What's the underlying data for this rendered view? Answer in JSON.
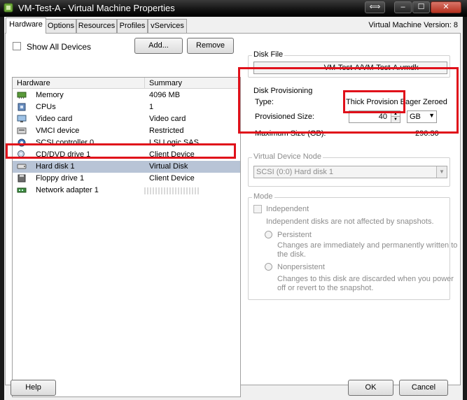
{
  "window": {
    "title": "VM-Test-A - Virtual Machine Properties",
    "version_label": "Virtual Machine Version: 8",
    "close_glyph": "✕",
    "min_glyph": "‒",
    "max_glyph": "☐",
    "resize_glyph": "⟺"
  },
  "tabs": [
    "Hardware",
    "Options",
    "Resources",
    "Profiles",
    "vServices"
  ],
  "toolbar": {
    "show_all_devices": "Show All Devices",
    "add_label": "Add...",
    "remove_label": "Remove"
  },
  "hardware": {
    "col_hardware": "Hardware",
    "col_summary": "Summary",
    "rows": [
      {
        "name": "Memory",
        "summary": "4096 MB",
        "icon": "memory-icon"
      },
      {
        "name": "CPUs",
        "summary": "1",
        "icon": "cpu-icon"
      },
      {
        "name": "Video card",
        "summary": "Video card",
        "icon": "monitor-icon"
      },
      {
        "name": "VMCI device",
        "summary": "Restricted",
        "icon": "vmci-icon"
      },
      {
        "name": "SCSI controller 0",
        "summary": "LSI Logic SAS",
        "icon": "scsi-icon"
      },
      {
        "name": "CD/DVD drive 1",
        "summary": "Client Device",
        "icon": "cd-drive-icon"
      },
      {
        "name": "Hard disk 1",
        "summary": "Virtual Disk",
        "icon": "hard-disk-icon"
      },
      {
        "name": "Floppy drive 1",
        "summary": "Client Device",
        "icon": "floppy-icon"
      },
      {
        "name": "Network adapter 1",
        "summary": "",
        "icon": "network-adapter-icon"
      }
    ],
    "selected_index": 6
  },
  "disk_file": {
    "label": "Disk File",
    "value": "-VM-Test-A/VM-Test-A.vmdk"
  },
  "provisioning": {
    "label": "Disk Provisioning",
    "type_label": "Type:",
    "type_value": "Thick Provision Eager Zeroed",
    "size_label": "Provisioned Size:",
    "size_value": "40",
    "unit_value": "GB",
    "max_label": "Maximum Size (GB):",
    "max_value": "290.30"
  },
  "vdn": {
    "label": "Virtual Device Node",
    "value": "SCSI (0:0) Hard disk 1"
  },
  "mode": {
    "label": "Mode",
    "independent": "Independent",
    "independent_desc": "Independent disks are not affected by snapshots.",
    "persistent": "Persistent",
    "persistent_desc1": "Changes are immediately and permanently written to",
    "persistent_desc2": "the disk.",
    "nonpersistent": "Nonpersistent",
    "nonpersistent_desc1": "Changes to this disk are discarded when you power",
    "nonpersistent_desc2": "off or revert to the snapshot."
  },
  "footer": {
    "help": "Help",
    "ok": "OK",
    "cancel": "Cancel"
  },
  "colors": {
    "highlight_red": "#e0101a",
    "selection": "#b8c4d6"
  }
}
